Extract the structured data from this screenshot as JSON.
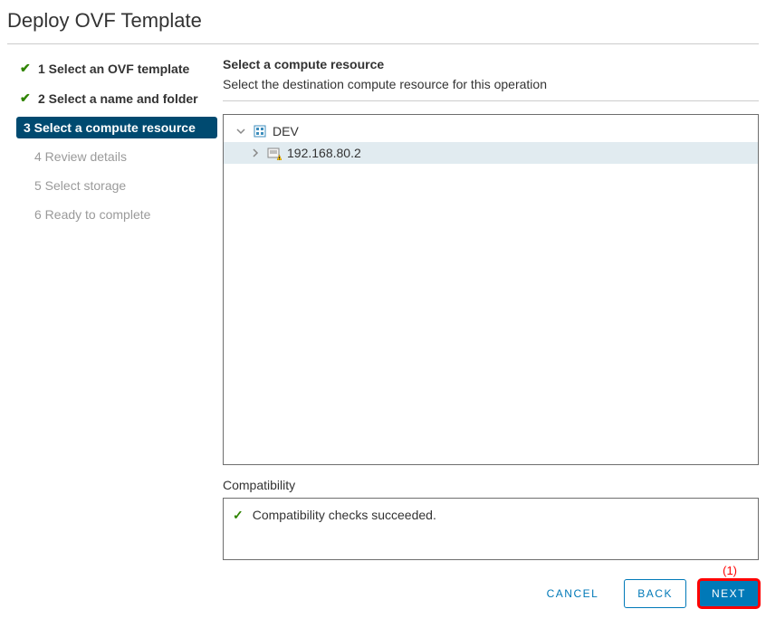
{
  "dialog": {
    "title": "Deploy OVF Template"
  },
  "steps": [
    {
      "label": "1 Select an OVF template",
      "state": "completed"
    },
    {
      "label": "2 Select a name and folder",
      "state": "completed"
    },
    {
      "label": "3 Select a compute resource",
      "state": "current"
    },
    {
      "label": "4 Review details",
      "state": "future"
    },
    {
      "label": "5 Select storage",
      "state": "future"
    },
    {
      "label": "6 Ready to complete",
      "state": "future"
    }
  ],
  "content": {
    "heading": "Select a compute resource",
    "subtext": "Select the destination compute resource for this operation"
  },
  "tree": {
    "root": {
      "label": "DEV"
    },
    "child": {
      "label": "192.168.80.2"
    }
  },
  "compat": {
    "label": "Compatibility",
    "message": "Compatibility checks succeeded."
  },
  "buttons": {
    "cancel": "CANCEL",
    "back": "BACK",
    "next": "NEXT"
  },
  "annotation": "(1)"
}
